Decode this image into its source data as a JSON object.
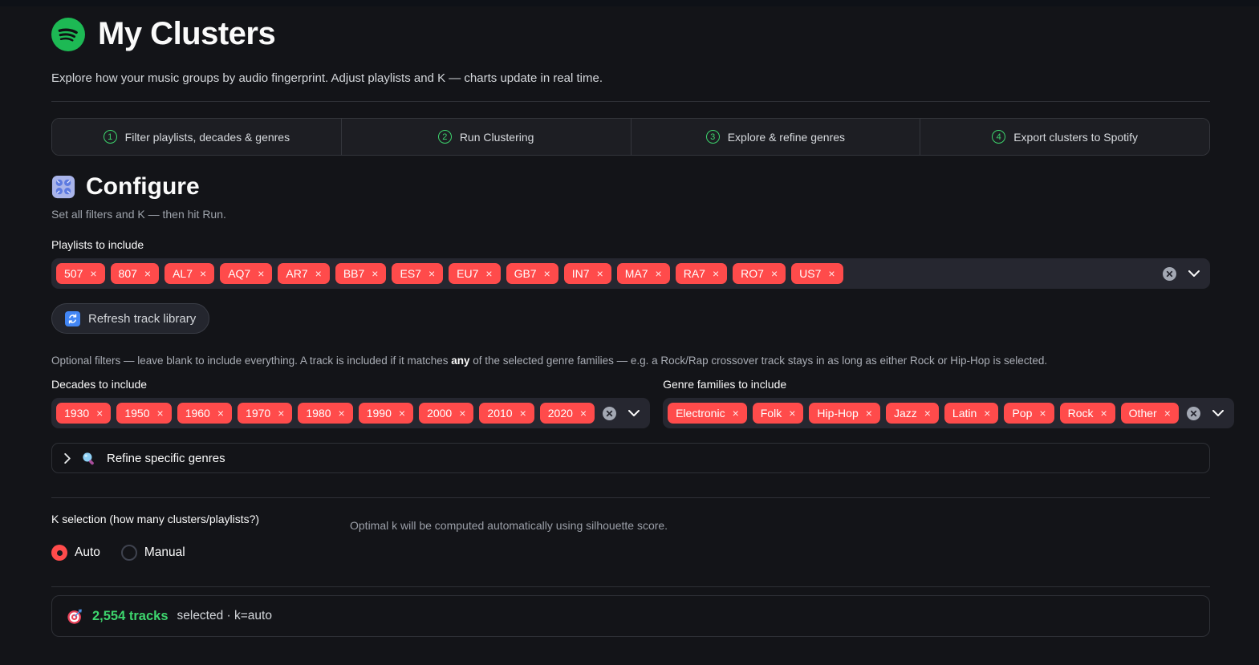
{
  "app": {
    "title": "My Clusters",
    "subtitle": "Explore how your music groups by audio fingerprint. Adjust playlists and K — charts update in real time."
  },
  "stepper": {
    "steps": [
      {
        "num": "1",
        "label": "Filter playlists, decades & genres"
      },
      {
        "num": "2",
        "label": "Run Clustering"
      },
      {
        "num": "3",
        "label": "Explore & refine genres"
      },
      {
        "num": "4",
        "label": "Export clusters to Spotify"
      }
    ]
  },
  "configure": {
    "heading": "Configure",
    "subheading": "Set all filters and K — then hit Run.",
    "playlists_label": "Playlists to include",
    "playlists": [
      "507",
      "807",
      "AL7",
      "AQ7",
      "AR7",
      "BB7",
      "ES7",
      "EU7",
      "GB7",
      "IN7",
      "MA7",
      "RA7",
      "RO7",
      "US7"
    ],
    "refresh_button": "Refresh track library",
    "filters_note": {
      "before": "Optional filters — leave blank to include everything. A track is included if it matches ",
      "bold": "any",
      "after": " of the selected genre families — e.g. a Rock/Rap crossover track stays in as long as either Rock or Hip-Hop is selected."
    },
    "decades_label": "Decades to include",
    "decades": [
      "1930",
      "1950",
      "1960",
      "1970",
      "1980",
      "1990",
      "2000",
      "2010",
      "2020"
    ],
    "genres_label": "Genre families to include",
    "genres": [
      "Electronic",
      "Folk",
      "Hip-Hop",
      "Jazz",
      "Latin",
      "Pop",
      "Rock",
      "Other"
    ],
    "refine_expander": "Refine specific genres",
    "k_label": "K selection (how many clusters/playlists?)",
    "k_hint": "Optimal k will be computed automatically using silhouette score.",
    "k_options": [
      {
        "label": "Auto",
        "selected": true
      },
      {
        "label": "Manual",
        "selected": false
      }
    ]
  },
  "status": {
    "tracks": "2,554 tracks",
    "rest": "selected · k=auto"
  },
  "icons": {
    "close_glyph": "×"
  },
  "colors": {
    "spotify_green": "#1db954",
    "tag_red": "#ff4b4b",
    "success_green": "#3dd56d",
    "refresh_blue": "#4286f5"
  }
}
